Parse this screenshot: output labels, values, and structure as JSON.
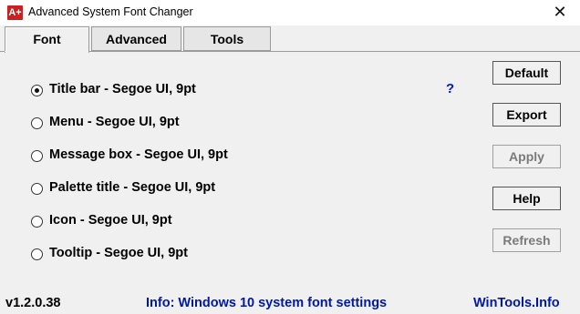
{
  "window": {
    "title": "Advanced System Font Changer",
    "icon_text": "A+",
    "close_glyph": "✕"
  },
  "tabs": [
    {
      "label": "Font",
      "active": true
    },
    {
      "label": "Advanced",
      "active": false
    },
    {
      "label": "Tools",
      "active": false
    }
  ],
  "font_items": [
    {
      "label": "Title bar - Segoe UI, 9pt",
      "selected": true
    },
    {
      "label": "Menu - Segoe UI, 9pt",
      "selected": false
    },
    {
      "label": "Message box - Segoe UI, 9pt",
      "selected": false
    },
    {
      "label": "Palette title - Segoe UI, 9pt",
      "selected": false
    },
    {
      "label": "Icon - Segoe UI, 9pt",
      "selected": false
    },
    {
      "label": "Tooltip - Segoe UI, 9pt",
      "selected": false
    }
  ],
  "help_link": "?",
  "buttons": {
    "default": {
      "label": "Default",
      "enabled": true
    },
    "export": {
      "label": "Export",
      "enabled": true
    },
    "apply": {
      "label": "Apply",
      "enabled": false
    },
    "help": {
      "label": "Help",
      "enabled": true
    },
    "refresh": {
      "label": "Refresh",
      "enabled": false
    }
  },
  "footer": {
    "version": "v1.2.0.38",
    "info": "Info: Windows 10 system font settings",
    "site": "WinTools.Info"
  },
  "colors": {
    "link_blue": "#0018a8",
    "icon_red": "#cc1f1f",
    "background": "#f0f0f0"
  }
}
